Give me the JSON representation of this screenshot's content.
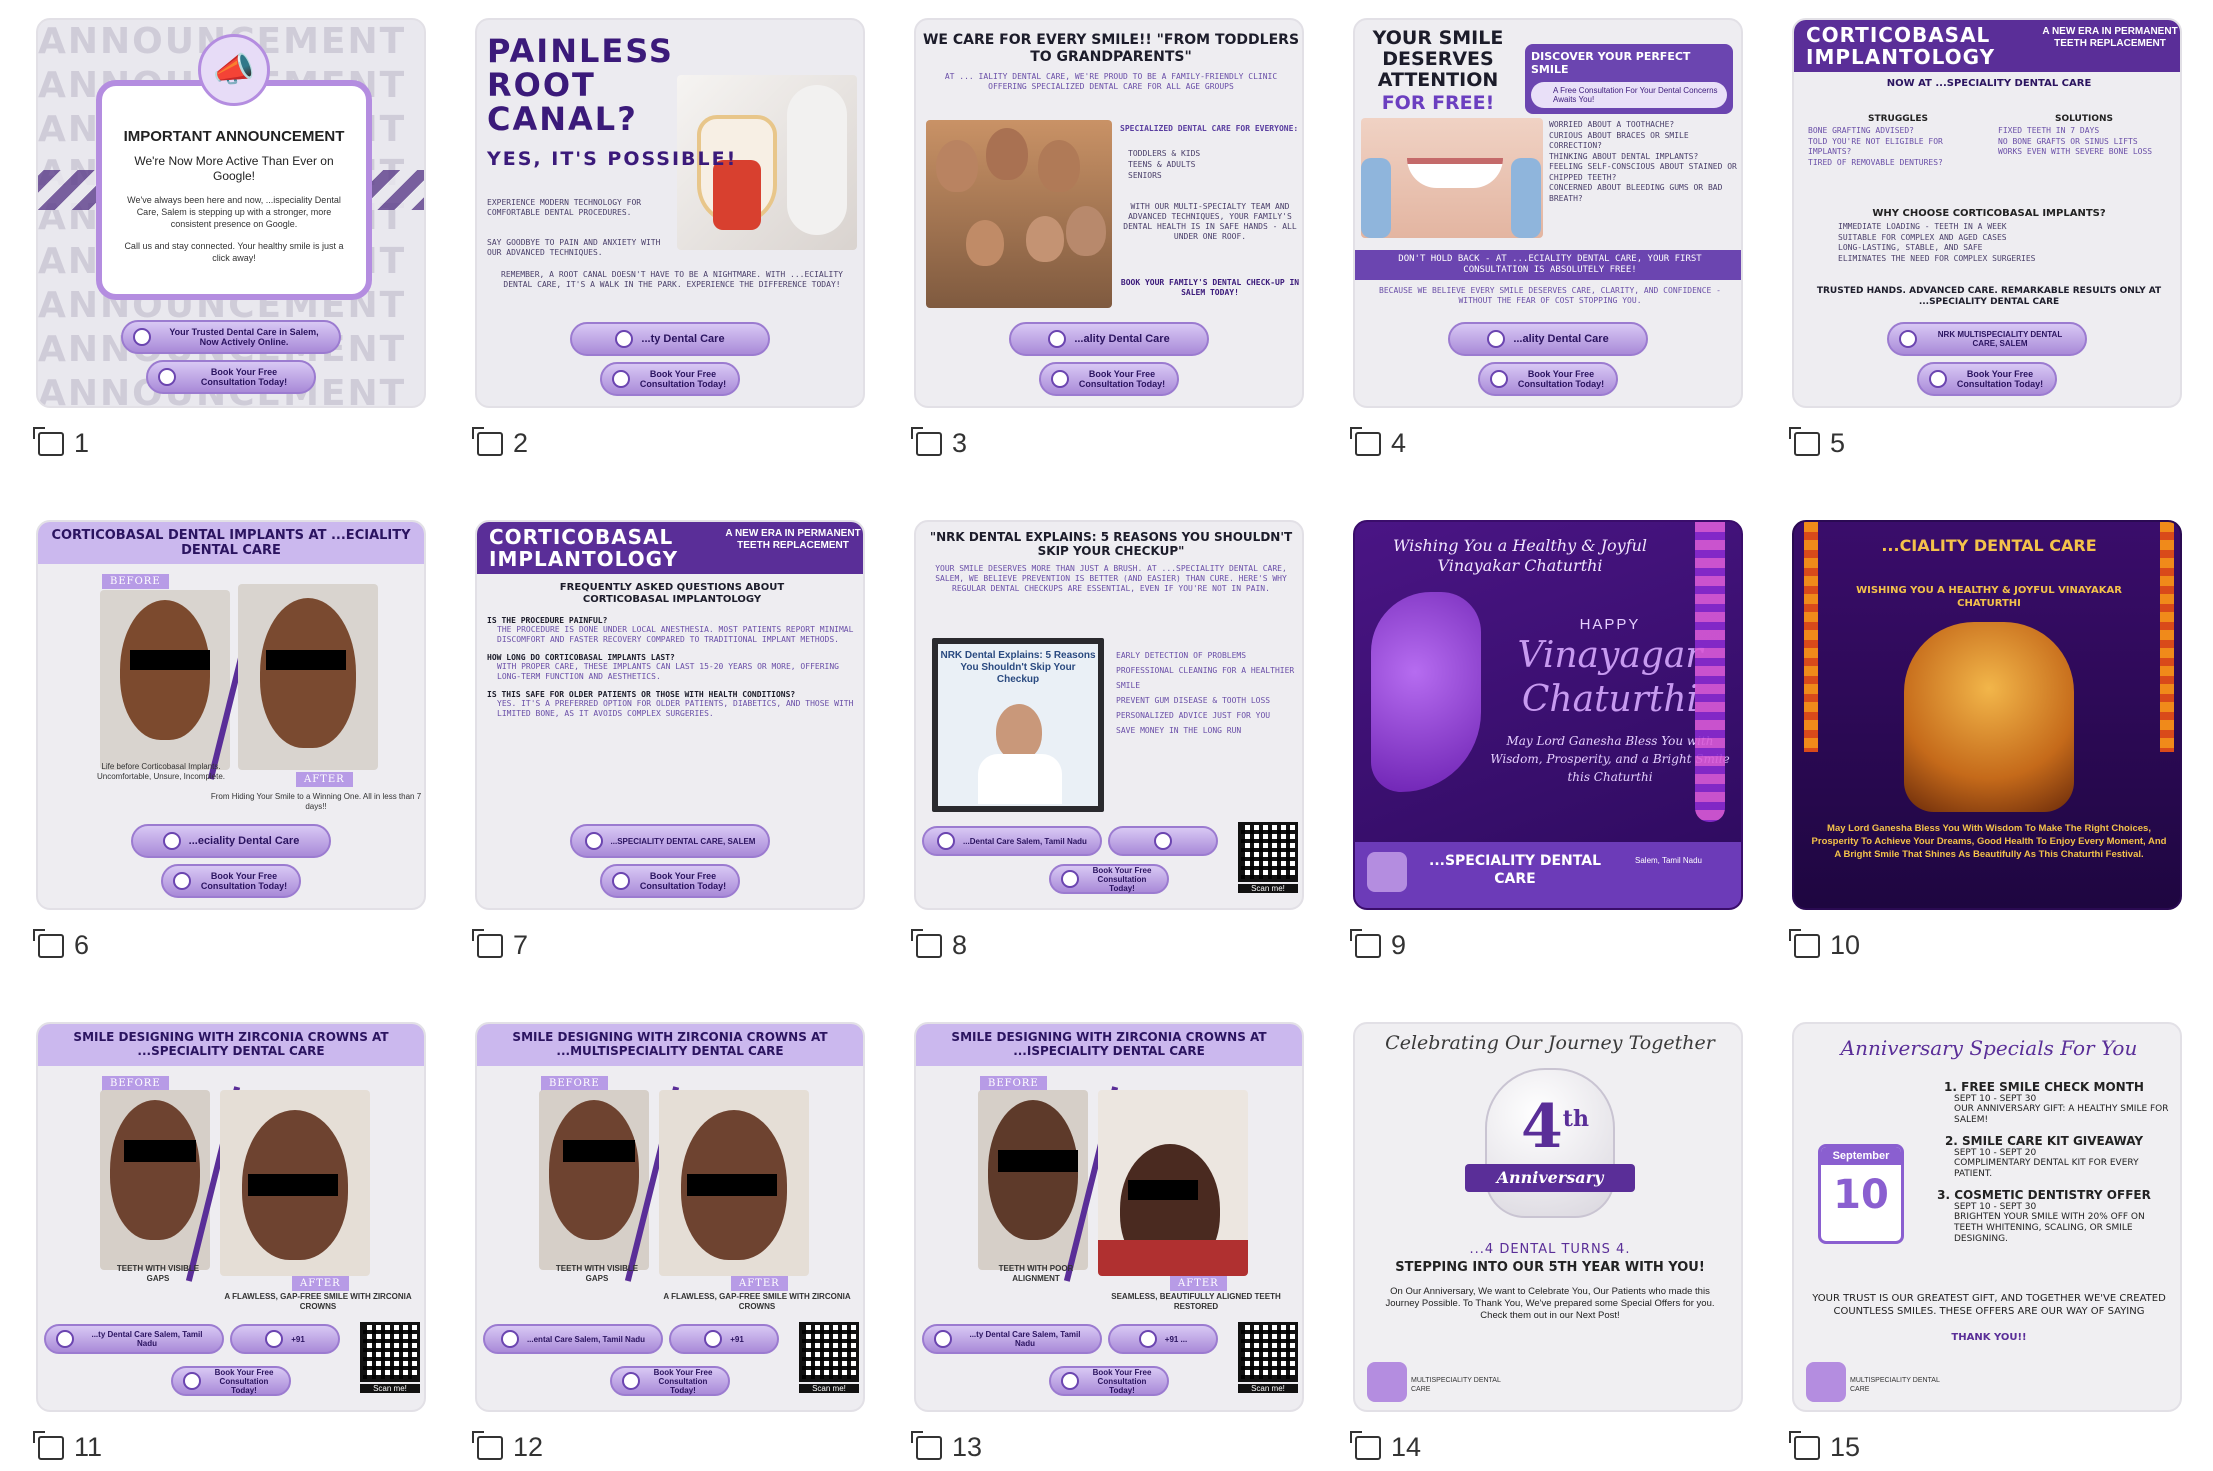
{
  "captions": [
    "1",
    "2",
    "3",
    "4",
    "5",
    "6",
    "7",
    "8",
    "9",
    "10",
    "11",
    "12",
    "13",
    "14",
    "15"
  ],
  "common": {
    "book_label": "Book Your Free Consultation Today!",
    "scan": "Scan me!"
  },
  "t1": {
    "bg_word": "ANNOUNCEMENT",
    "title": "IMPORTANT ANNOUNCEMENT",
    "headline": "We're Now More Active Than Ever on Google!",
    "body1": "We've always been here and now, ...ispeciality Dental Care, Salem is stepping up with a stronger, more consistent presence on Google.",
    "body2": "Call us and stay connected. Your healthy smile is just a click away!",
    "pill": "Your Trusted Dental Care in Salem, Now Actively Online."
  },
  "t2": {
    "title": "PAINLESS ROOT CANAL?",
    "sub": "YES, IT'S POSSIBLE!",
    "p1": "EXPERIENCE MODERN TECHNOLOGY FOR COMFORTABLE DENTAL PROCEDURES.",
    "p2": "SAY GOODBYE TO PAIN AND ANXIETY WITH OUR ADVANCED TECHNIQUES.",
    "p3": "REMEMBER, A ROOT CANAL DOESN'T HAVE TO BE A NIGHTMARE. WITH ...ECIALITY DENTAL CARE, IT'S A WALK IN THE PARK. EXPERIENCE THE DIFFERENCE TODAY!",
    "pill": "...ty Dental Care"
  },
  "t3": {
    "title": "WE CARE FOR EVERY SMILE!! \"FROM TODDLERS TO GRANDPARENTS\"",
    "intro": "AT ... IALITY DENTAL CARE, WE'RE PROUD TO BE A FAMILY-FRIENDLY CLINIC OFFERING SPECIALIZED DENTAL CARE FOR ALL AGE GROUPS",
    "list_head": "SPECIALIZED DENTAL CARE FOR EVERYONE:",
    "items": [
      "TODDLERS & KIDS",
      "TEENS & ADULTS",
      "SENIORS"
    ],
    "p2": "WITH OUR MULTI-SPECIALTY TEAM AND ADVANCED TECHNIQUES, YOUR FAMILY'S DENTAL HEALTH IS IN SAFE HANDS - ALL UNDER ONE ROOF.",
    "p3": "BOOK YOUR FAMILY'S DENTAL CHECK-UP IN SALEM TODAY!",
    "pill": "...ality Dental Care"
  },
  "t4": {
    "title": "YOUR SMILE DESERVES ATTENTION",
    "title2": "FOR FREE!",
    "box_head": "DISCOVER YOUR PERFECT SMILE",
    "box_sub": "A Free Consultation For Your Dental Concerns Awaits You!",
    "items": [
      "WORRIED ABOUT A TOOTHACHE?",
      "CURIOUS ABOUT BRACES OR SMILE CORRECTION?",
      "THINKING ABOUT DENTAL IMPLANTS?",
      "FEELING SELF-CONSCIOUS ABOUT STAINED OR CHIPPED TEETH?",
      "CONCERNED ABOUT BLEEDING GUMS OR BAD BREATH?"
    ],
    "band": "DON'T HOLD BACK - AT ...ECIALITY DENTAL CARE, YOUR FIRST CONSULTATION IS ABSOLUTELY FREE!",
    "foot": "BECAUSE WE BELIEVE EVERY SMILE DESERVES CARE, CLARITY, AND CONFIDENCE - WITHOUT THE FEAR OF COST STOPPING YOU.",
    "pill": "...ality Dental Care"
  },
  "t5": {
    "title": "CORTICOBASAL IMPLANTOLOGY",
    "right": "A NEW ERA IN PERMANENT TEETH REPLACEMENT",
    "now": "NOW AT ...SPECIALITY DENTAL CARE",
    "col1_head": "STRUGGLES",
    "col1": [
      "BONE GRAFTING ADVISED?",
      "TOLD YOU'RE NOT ELIGIBLE FOR IMPLANTS?",
      "TIRED OF REMOVABLE DENTURES?"
    ],
    "col2_head": "SOLUTIONS",
    "col2": [
      "FIXED TEETH IN 7 DAYS",
      "NO BONE GRAFTS OR SINUS LIFTS",
      "WORKS EVEN WITH SEVERE BONE LOSS"
    ],
    "why": "WHY CHOOSE CORTICOBASAL IMPLANTS?",
    "why_items": [
      "IMMEDIATE LOADING - TEETH IN A WEEK",
      "SUITABLE FOR COMPLEX AND AGED CASES",
      "LONG-LASTING, STABLE, AND SAFE",
      "ELIMINATES THE NEED FOR COMPLEX SURGERIES"
    ],
    "trust": "TRUSTED HANDS. ADVANCED CARE. REMARKABLE RESULTS ONLY AT ...SPECIALITY DENTAL CARE",
    "pill": "NRK MULTISPECIALITY DENTAL CARE, SALEM"
  },
  "t6": {
    "title": "CORTICOBASAL DENTAL IMPLANTS AT ...ECIALITY DENTAL CARE",
    "before": "BEFORE",
    "after": "AFTER",
    "cap_l": "Life before Corticobasal Implants. Uncomfortable, Unsure, Incomplete.",
    "cap_r": "From Hiding Your Smile to a Winning One. All in less than 7 days!!",
    "pill": "...eciality Dental Care"
  },
  "t7": {
    "title": "CORTICOBASAL IMPLANTOLOGY",
    "right": "A NEW ERA IN PERMANENT TEETH REPLACEMENT",
    "faq": "FREQUENTLY ASKED QUESTIONS ABOUT CORTICOBASAL IMPLANTOLOGY",
    "q1": "IS THE PROCEDURE PAINFUL?",
    "a1": "THE PROCEDURE IS DONE UNDER LOCAL ANESTHESIA. MOST PATIENTS REPORT MINIMAL DISCOMFORT AND FASTER RECOVERY COMPARED TO TRADITIONAL IMPLANT METHODS.",
    "q2": "HOW LONG DO CORTICOBASAL IMPLANTS LAST?",
    "a2": "WITH PROPER CARE, THESE IMPLANTS CAN LAST 15-20 YEARS OR MORE, OFFERING LONG-TERM FUNCTION AND AESTHETICS.",
    "q3": "IS THIS SAFE FOR OLDER PATIENTS OR THOSE WITH HEALTH CONDITIONS?",
    "a3": "YES. IT'S A PREFERRED OPTION FOR OLDER PATIENTS, DIABETICS, AND THOSE WITH LIMITED BONE, AS IT AVOIDS COMPLEX SURGERIES.",
    "pill": "...SPECIALITY DENTAL CARE, SALEM"
  },
  "t8": {
    "title": "\"NRK DENTAL EXPLAINS: 5 REASONS YOU SHOULDN'T SKIP YOUR CHECKUP\"",
    "intro": "YOUR SMILE DESERVES MORE THAN JUST A BRUSH. AT ...SPECIALITY DENTAL CARE, SALEM, WE BELIEVE PREVENTION IS BETTER (AND EASIER) THAN CURE. HERE'S WHY REGULAR DENTAL CHECKUPS ARE ESSENTIAL, EVEN IF YOU'RE NOT IN PAIN.",
    "video": "NRK Dental Explains: 5 Reasons You Shouldn't Skip Your Checkup",
    "items": [
      "EARLY DETECTION OF PROBLEMS",
      "PROFESSIONAL CLEANING FOR A HEALTHIER SMILE",
      "PREVENT GUM DISEASE & TOOTH LOSS",
      "PERSONALIZED ADVICE JUST FOR YOU",
      "SAVE MONEY IN THE LONG RUN"
    ],
    "pill": "...Dental Care Salem, Tamil Nadu"
  },
  "t9": {
    "top": "Wishing You a Healthy & Joyful Vinayakar Chaturthi",
    "happy": "HAPPY",
    "big": "Vinayagar Chaturthi",
    "bless": "May Lord Ganesha Bless You with Wisdom, Prosperity, and a Bright Smile this Chaturthi",
    "brand": "...SPECIALITY DENTAL CARE",
    "loc": "Salem, Tamil Nadu"
  },
  "t10": {
    "brand": "...CIALITY DENTAL CARE",
    "wish": "WISHING YOU A HEALTHY & JOYFUL VINAYAKAR CHATURTHI",
    "bless": "May Lord Ganesha Bless You With Wisdom To Make The Right Choices, Prosperity To Achieve Your Dreams, Good Health To Enjoy Every Moment, And A Bright Smile That Shines As Beautifully As This Chaturthi Festival."
  },
  "t11": {
    "title": "SMILE DESIGNING WITH ZIRCONIA CROWNS AT ...SPECIALITY DENTAL CARE",
    "before": "BEFORE",
    "after": "AFTER",
    "cap_l": "TEETH WITH VISIBLE GAPS",
    "cap_r": "A FLAWLESS, GAP-FREE SMILE WITH ZIRCONIA CROWNS",
    "pill": "...ty Dental Care Salem, Tamil Nadu",
    "phone": "+91"
  },
  "t12": {
    "title": "SMILE DESIGNING WITH ZIRCONIA CROWNS AT ...MULTISPECIALITY DENTAL CARE",
    "before": "BEFORE",
    "after": "AFTER",
    "cap_l": "TEETH WITH VISIBLE GAPS",
    "cap_r": "A FLAWLESS, GAP-FREE SMILE WITH ZIRCONIA CROWNS",
    "pill": "...ental Care Salem, Tamil Nadu",
    "phone": "+91"
  },
  "t13": {
    "title": "SMILE DESIGNING WITH ZIRCONIA CROWNS AT ...ISPECIALITY DENTAL CARE",
    "before": "BEFORE",
    "after": "AFTER",
    "cap_l": "TEETH WITH POOR ALIGNMENT",
    "cap_r": "SEAMLESS, BEAUTIFULLY ALIGNED TEETH RESTORED",
    "pill": "...ty Dental Care Salem, Tamil Nadu",
    "phone": "+91 ..."
  },
  "t14": {
    "top": "Celebrating Our Journey Together",
    "num": "4",
    "sup": "th",
    "ribbon": "Anniversary",
    "l1": "...4 DENTAL TURNS 4.",
    "l2": "STEPPING INTO OUR 5TH YEAR WITH YOU!",
    "body": "On Our Anniversary, We want to Celebrate You, Our Patients who made this Journey Possible. To Thank You, We've prepared some Special Offers for you. Check them out in our Next Post!",
    "logo": "MULTISPECIALITY DENTAL CARE"
  },
  "t15": {
    "top": "Anniversary Specials For You",
    "month": "September",
    "day": "10",
    "h1": "1. FREE SMILE CHECK MONTH",
    "h1a": "SEPT 10 - SEPT 30",
    "h1b": "OUR ANNIVERSARY GIFT: A HEALTHY SMILE FOR SALEM!",
    "h2": "2. SMILE CARE KIT GIVEAWAY",
    "h2a": "SEPT 10 - SEPT 20",
    "h2b": "COMPLIMENTARY DENTAL KIT FOR EVERY PATIENT.",
    "h3": "3. COSMETIC DENTISTRY OFFER",
    "h3a": "SEPT 10 - SEPT 30",
    "h3b": "BRIGHTEN YOUR SMILE WITH 20% OFF ON TEETH WHITENING, SCALING, OR SMILE DESIGNING.",
    "foot": "YOUR TRUST IS OUR GREATEST GIFT, AND TOGETHER WE'VE CREATED COUNTLESS SMILES. THESE OFFERS ARE OUR WAY OF SAYING",
    "thanks": "THANK YOU!!",
    "logo": "MULTISPECIALITY DENTAL CARE"
  }
}
